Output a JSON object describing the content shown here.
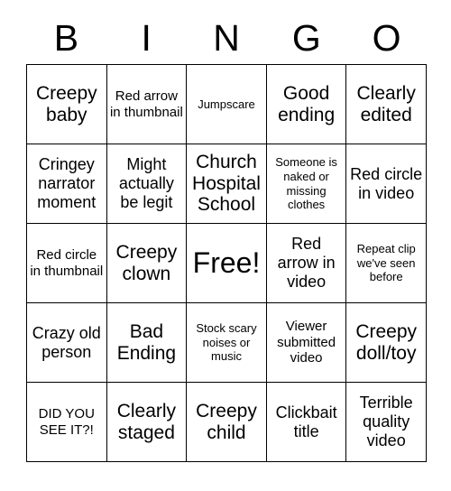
{
  "card": {
    "title": "BINGO",
    "header_letters": [
      "B",
      "I",
      "N",
      "G",
      "O"
    ],
    "grid_size": 5,
    "colors": {
      "background": "#ffffff",
      "text": "#000000",
      "border": "#000000"
    },
    "rows": [
      [
        {
          "text": "Creepy baby",
          "size": "lg",
          "free": false
        },
        {
          "text": "Red arrow in thumbnail",
          "size": "sm",
          "free": false
        },
        {
          "text": "Jumpscare",
          "size": "xs",
          "free": false
        },
        {
          "text": "Good ending",
          "size": "lg",
          "free": false
        },
        {
          "text": "Clearly edited",
          "size": "lg",
          "free": false
        }
      ],
      [
        {
          "text": "Cringey narrator moment",
          "size": "md",
          "free": false
        },
        {
          "text": "Might actually be legit",
          "size": "md",
          "free": false
        },
        {
          "text": "Church Hospital School",
          "size": "lg",
          "free": false
        },
        {
          "text": "Someone is naked or missing clothes",
          "size": "xs",
          "free": false
        },
        {
          "text": "Red circle in video",
          "size": "md",
          "free": false
        }
      ],
      [
        {
          "text": "Red circle in thumbnail",
          "size": "sm",
          "free": false
        },
        {
          "text": "Creepy clown",
          "size": "lg",
          "free": false
        },
        {
          "text": "Free!",
          "size": "xl",
          "free": true
        },
        {
          "text": "Red arrow in video",
          "size": "md",
          "free": false
        },
        {
          "text": "Repeat clip we've seen before",
          "size": "xs",
          "free": false
        }
      ],
      [
        {
          "text": "Crazy old person",
          "size": "md",
          "free": false
        },
        {
          "text": "Bad Ending",
          "size": "lg",
          "free": false
        },
        {
          "text": "Stock scary noises or music",
          "size": "xs",
          "free": false
        },
        {
          "text": "Viewer submitted video",
          "size": "sm",
          "free": false
        },
        {
          "text": "Creepy doll/toy",
          "size": "lg",
          "free": false
        }
      ],
      [
        {
          "text": "DID YOU SEE IT?!",
          "size": "sm",
          "free": false
        },
        {
          "text": "Clearly staged",
          "size": "lg",
          "free": false
        },
        {
          "text": "Creepy child",
          "size": "lg",
          "free": false
        },
        {
          "text": "Clickbait title",
          "size": "md",
          "free": false
        },
        {
          "text": "Terrible quality video",
          "size": "md",
          "free": false
        }
      ]
    ]
  }
}
